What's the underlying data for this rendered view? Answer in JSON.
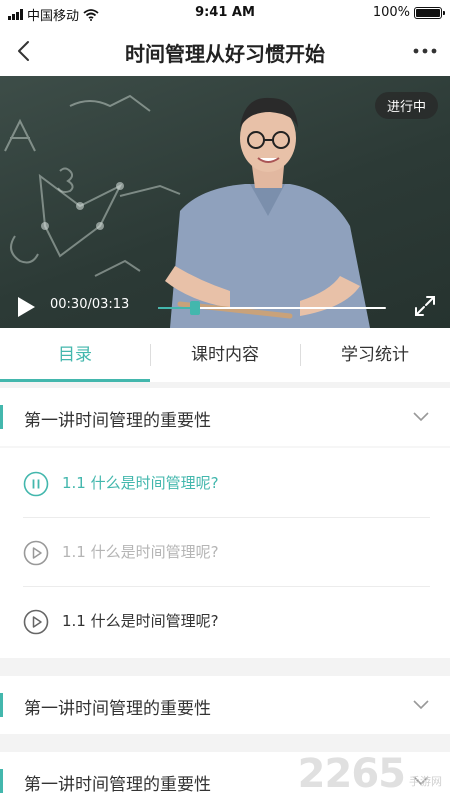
{
  "status_bar": {
    "carrier": "中国移动",
    "time": "9:41 AM",
    "battery_percent": "100%",
    "battery_level": 1.0
  },
  "nav": {
    "title": "时间管理从好习惯开始"
  },
  "video": {
    "status_badge": "进行中",
    "current_time": "00:30",
    "duration": "03:13",
    "time_display": "00:30/03:13",
    "progress": 0.155,
    "accent_color": "#43b7ad"
  },
  "tabs": [
    {
      "label": "目录",
      "active": true
    },
    {
      "label": "课时内容",
      "active": false
    },
    {
      "label": "学习统计",
      "active": false
    }
  ],
  "sections": [
    {
      "title": "第一讲时间管理的重要性",
      "expanded": true
    },
    {
      "title": "第一讲时间管理的重要性",
      "expanded": false
    },
    {
      "title": "第一讲时间管理的重要性",
      "expanded": false
    }
  ],
  "lessons": [
    {
      "title": "1.1 什么是时间管理呢?",
      "state": "playing",
      "icon": "pause-circle-icon"
    },
    {
      "title": "1.1 什么是时间管理呢?",
      "state": "disabled",
      "icon": "play-circle-icon"
    },
    {
      "title": "1.1 什么是时间管理呢?",
      "state": "normal",
      "icon": "play-circle-icon"
    }
  ],
  "watermark": {
    "number": "2265",
    "suffix": "手游网"
  }
}
